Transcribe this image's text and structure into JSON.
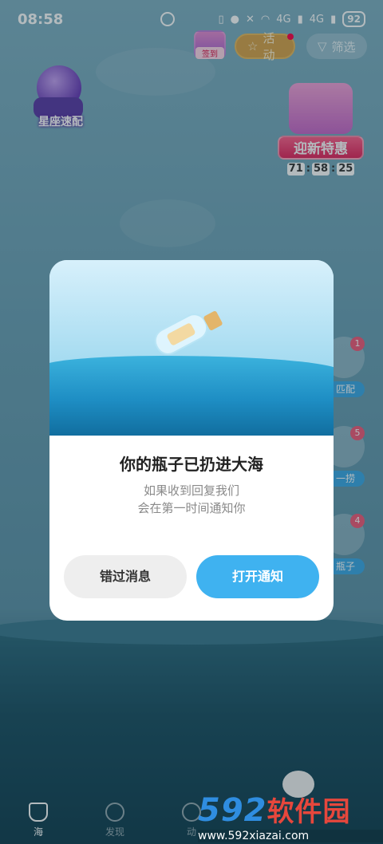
{
  "status_bar": {
    "time": "08:58",
    "network1": "4G",
    "network2": "4G",
    "battery": "92"
  },
  "top": {
    "signin_label": "签到",
    "activity_label": "活动",
    "filter_label": "筛选"
  },
  "left_widget": {
    "label": "星座速配"
  },
  "promo": {
    "title": "迎新特惠",
    "countdown": [
      "71",
      "58",
      "25"
    ]
  },
  "side_items": [
    {
      "badge": "1",
      "label": "匹配"
    },
    {
      "badge": "5",
      "label": "一捞"
    },
    {
      "badge": "4",
      "label": "瓶子"
    }
  ],
  "modal": {
    "title": "你的瓶子已扔进大海",
    "subtitle_line1": "如果收到回复我们",
    "subtitle_line2": "会在第一时间通知你",
    "miss_button": "错过消息",
    "open_button": "打开通知"
  },
  "nav": {
    "tabs": [
      {
        "label": "海",
        "icon": "bottle-icon",
        "active": true
      },
      {
        "label": "发现",
        "icon": "planet-icon",
        "active": false
      },
      {
        "label": "动",
        "icon": "star-icon",
        "active": false
      }
    ]
  },
  "watermark": {
    "brand_num": "592",
    "brand_text": "软件园",
    "url": "www.592xiazai.com"
  },
  "colors": {
    "accent": "#3fb2f0",
    "activity": "#d8a34a",
    "promo": "#e2245c"
  }
}
